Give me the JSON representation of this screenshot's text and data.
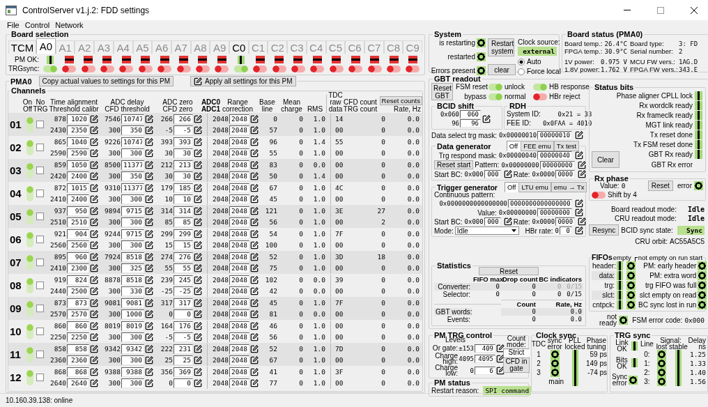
{
  "window": {
    "title": "ControlServer v1.j.2: FDD settings"
  },
  "menu": [
    "File",
    "Control",
    "Network"
  ],
  "board_selection": {
    "title": "Board selection",
    "tcm": {
      "label": "TCM",
      "selected": false
    },
    "pm_ok_label": "PM OK:",
    "trg_sync_label": "TRGsync:",
    "boards": [
      {
        "label": "A0",
        "selected": true,
        "pm_ok": true,
        "trg_sync": true
      },
      {
        "label": "A1",
        "selected": false,
        "pm_ok": false,
        "trg_sync": false
      },
      {
        "label": "A2",
        "selected": false,
        "pm_ok": false,
        "trg_sync": false
      },
      {
        "label": "A3",
        "selected": false,
        "pm_ok": false,
        "trg_sync": false
      },
      {
        "label": "A4",
        "selected": false,
        "pm_ok": false,
        "trg_sync": false
      },
      {
        "label": "A5",
        "selected": false,
        "pm_ok": false,
        "trg_sync": false
      },
      {
        "label": "A6",
        "selected": false,
        "pm_ok": false,
        "trg_sync": false
      },
      {
        "label": "A7",
        "selected": false,
        "pm_ok": false,
        "trg_sync": false
      },
      {
        "label": "A8",
        "selected": false,
        "pm_ok": false,
        "trg_sync": false
      },
      {
        "label": "A9",
        "selected": false,
        "pm_ok": false,
        "trg_sync": false
      },
      {
        "label": "C0",
        "selected": false,
        "pm_ok": true,
        "trg_sync": true
      },
      {
        "label": "C1",
        "selected": false,
        "pm_ok": false,
        "trg_sync": false
      },
      {
        "label": "C2",
        "selected": false,
        "pm_ok": false,
        "trg_sync": false
      },
      {
        "label": "C3",
        "selected": false,
        "pm_ok": false,
        "trg_sync": false
      },
      {
        "label": "C4",
        "selected": false,
        "pm_ok": false,
        "trg_sync": false
      },
      {
        "label": "C5",
        "selected": false,
        "pm_ok": false,
        "trg_sync": false
      },
      {
        "label": "C6",
        "selected": false,
        "pm_ok": false,
        "trg_sync": false
      },
      {
        "label": "C7",
        "selected": false,
        "pm_ok": false,
        "trg_sync": false
      },
      {
        "label": "C8",
        "selected": false,
        "pm_ok": false,
        "trg_sync": false
      },
      {
        "label": "C9",
        "selected": false,
        "pm_ok": false,
        "trg_sync": false
      }
    ]
  },
  "pm": {
    "title": "PMA0",
    "copy_button": "Copy actual values to settings for this PM",
    "apply_button": "Apply all settings for this PM",
    "channels": {
      "title": "Channels",
      "reset_button": "Reset counts",
      "columns": [
        {
          "lines": [
            "On",
            "Off"
          ],
          "bold": false
        },
        {
          "lines": [
            "No",
            "TRG"
          ],
          "bold": false
        },
        {
          "lines": [
            "Time alignment",
            "Threshold calibr"
          ],
          "bold": false
        },
        {
          "lines": [
            "ADC delay",
            "CFD threshold"
          ],
          "bold": false
        },
        {
          "lines": [
            "ADC zero",
            "CFD zero"
          ],
          "bold": false
        },
        {
          "lines": [
            "ADC0",
            "ADC1"
          ],
          "bold": true
        },
        {
          "lines": [
            "Range",
            "correction"
          ],
          "bold": false
        },
        {
          "lines": [
            "Base",
            "line"
          ],
          "bold": false
        },
        {
          "lines": [
            "Mean",
            "charge"
          ],
          "bold": false
        },
        {
          "lines": [
            "RMS"
          ],
          "bold": false
        },
        {
          "lines": [
            "TDC",
            "raw",
            "data"
          ],
          "bold": false
        },
        {
          "lines": [
            "CFD count",
            "TRG count"
          ],
          "bold": false
        },
        {
          "lines": [
            "Rate, Hz"
          ],
          "bold": false
        }
      ],
      "rows": [
        {
          "number": "01",
          "on": true,
          "no_trg": false,
          "lines": [
            [
              "878",
              "1020",
              "7546",
              "10747",
              "266",
              "266",
              "2048",
              "2048",
              "0",
              "0",
              "1.0",
              "14",
              "0",
              "0.0"
            ],
            [
              "2430",
              "2350",
              "300",
              "350",
              "-5",
              "-5",
              "2048",
              "2048",
              "57",
              "0",
              "1.0",
              "00",
              "0",
              "0.0"
            ]
          ]
        },
        {
          "number": "02",
          "on": true,
          "no_trg": false,
          "lines": [
            [
              "865",
              "1040",
              "9226",
              "10747",
              "393",
              "393",
              "2048",
              "2048",
              "96",
              "0",
              "1.4",
              "55",
              "0",
              "0.0"
            ],
            [
              "2590",
              "2590",
              "300",
              "300",
              "30",
              "30",
              "2048",
              "2048",
              "55",
              "0",
              "1.0",
              "00",
              "0",
              "0.0"
            ]
          ]
        },
        {
          "number": "03",
          "on": true,
          "no_trg": false,
          "lines": [
            [
              "859",
              "1050",
              "8500",
              "11377",
              "212",
              "213",
              "2048",
              "2048",
              "83",
              "0",
              "0.0",
              "00",
              "0",
              "0.0"
            ],
            [
              "2420",
              "2400",
              "300",
              "350",
              "30",
              "30",
              "2048",
              "2048",
              "50",
              "0",
              "1.4",
              "00",
              "0",
              "0.0"
            ]
          ]
        },
        {
          "number": "04",
          "on": true,
          "no_trg": false,
          "lines": [
            [
              "872",
              "1015",
              "9310",
              "11377",
              "179",
              "185",
              "2048",
              "2048",
              "67",
              "0",
              "1.0",
              "4C",
              "0",
              "0.0"
            ],
            [
              "2410",
              "2400",
              "300",
              "300",
              "10",
              "10",
              "2048",
              "2048",
              "45",
              "0",
              "1.0",
              "00",
              "0",
              "0.0"
            ]
          ]
        },
        {
          "number": "05",
          "on": true,
          "no_trg": false,
          "lines": [
            [
              "937",
              "950",
              "9894",
              "9715",
              "314",
              "314",
              "2048",
              "2048",
              "121",
              "0",
              "1.0",
              "3E",
              "27",
              "0.0"
            ],
            [
              "2510",
              "2510",
              "300",
              "300",
              "85",
              "85",
              "2048",
              "2048",
              "56",
              "0",
              "1.0",
              "00",
              "2",
              "0.0"
            ]
          ]
        },
        {
          "number": "06",
          "on": true,
          "no_trg": false,
          "lines": [
            [
              "921",
              "904",
              "9244",
              "9715",
              "299",
              "299",
              "2048",
              "2048",
              "54",
              "0",
              "1.0",
              "7F",
              "0",
              "0.0"
            ],
            [
              "2560",
              "2560",
              "300",
              "300",
              "15",
              "15",
              "2048",
              "2048",
              "100",
              "0",
              "1.0",
              "00",
              "0",
              "0.0"
            ]
          ]
        },
        {
          "number": "07",
          "on": true,
          "no_trg": false,
          "lines": [
            [
              "895",
              "960",
              "7924",
              "8518",
              "274",
              "276",
              "2048",
              "2048",
              "52",
              "0",
              "1.0",
              "3D",
              "18",
              "0.0"
            ],
            [
              "2410",
              "2300",
              "300",
              "325",
              "55",
              "55",
              "2048",
              "2048",
              "75",
              "0",
              "1.0",
              "00",
              "0",
              "0.0"
            ]
          ]
        },
        {
          "number": "08",
          "on": true,
          "no_trg": false,
          "lines": [
            [
              "919",
              "824",
              "8878",
              "8518",
              "239",
              "245",
              "2048",
              "2048",
              "102",
              "0",
              "0.0",
              "39",
              "0",
              "0.0"
            ],
            [
              "2440",
              "2500",
              "300",
              "330",
              "-25",
              "-25",
              "2048",
              "2048",
              "42",
              "0",
              "0.0",
              "00",
              "0",
              "0.0"
            ]
          ]
        },
        {
          "number": "09",
          "on": true,
          "no_trg": false,
          "lines": [
            [
              "873",
              "873",
              "9081",
              "9081",
              "317",
              "317",
              "2048",
              "2048",
              "45",
              "0",
              "1.0",
              "7F",
              "0",
              "0.0"
            ],
            [
              "2570",
              "2570",
              "300",
              "1000",
              "0",
              "0",
              "2048",
              "2048",
              "81",
              "0",
              "0.0",
              "00",
              "0",
              "0.0"
            ]
          ]
        },
        {
          "number": "10",
          "on": true,
          "no_trg": false,
          "lines": [
            [
              "860",
              "860",
              "8019",
              "8019",
              "164",
              "176",
              "2048",
              "2048",
              "46",
              "0",
              "1.0",
              "00",
              "0",
              "0.0"
            ],
            [
              "2250",
              "2250",
              "300",
              "300",
              "-5",
              "-5",
              "2048",
              "2048",
              "56",
              "0",
              "1.0",
              "00",
              "0",
              "0.0"
            ]
          ]
        },
        {
          "number": "11",
          "on": true,
          "no_trg": false,
          "lines": [
            [
              "858",
              "858",
              "9342",
              "9342",
              "222",
              "231",
              "2048",
              "2048",
              "52",
              "0",
              "1.0",
              "7D",
              "0",
              "0.0"
            ],
            [
              "2360",
              "2360",
              "300",
              "300",
              "25",
              "25",
              "2048",
              "2048",
              "67",
              "0",
              "1.0",
              "00",
              "0",
              "0.0"
            ]
          ]
        },
        {
          "number": "12",
          "on": true,
          "no_trg": false,
          "lines": [
            [
              "868",
              "868",
              "9388",
              "9388",
              "356",
              "369",
              "2048",
              "2048",
              "41",
              "0",
              "1.0",
              "3F",
              "0",
              "0.0"
            ],
            [
              "2640",
              "2640",
              "300",
              "300",
              "0",
              "0",
              "2048",
              "2048",
              "77",
              "0",
              "1.0",
              "00",
              "0",
              "0.0"
            ]
          ]
        }
      ]
    }
  },
  "system": {
    "title": "System",
    "indicators": [
      {
        "label": "is restarting",
        "ok": true
      },
      {
        "label": "restarted",
        "ok": true
      },
      {
        "label": "Errors present",
        "ok": true
      }
    ],
    "restart_button": "Restart system",
    "clear_button": "clear",
    "clock_source": {
      "label": "Clock source:",
      "value": "external",
      "options": [
        {
          "label": "Auto",
          "selected": true
        },
        {
          "label": "Force local",
          "selected": false
        }
      ]
    }
  },
  "board_status": {
    "title": "Board status (PMA0)",
    "items": [
      {
        "label": "Board temp.:",
        "value": "26.4°C"
      },
      {
        "label": "FPGA temp.:",
        "value": "30.9°C"
      },
      {
        "label": "1V power:",
        "value": "0.975 V"
      },
      {
        "label": "1.8V power:",
        "value": "1.762 V"
      }
    ],
    "items_2": [
      {
        "label": "Board type:",
        "value": "3: FD"
      },
      {
        "label": "Serial number:",
        "value": "2"
      },
      {
        "label": "MCU FW vers.:",
        "value": "1AG.D"
      },
      {
        "label": "FPGA FW vers.:",
        "value": "343.E"
      }
    ]
  },
  "gbt": {
    "title": "GBT readout",
    "reset_button": "Reset GBT",
    "switches": [
      {
        "off_label": "FSM reset",
        "on_label": "unlock",
        "on": true
      },
      {
        "off_label": "bypass",
        "on_label": "normal",
        "on": true
      }
    ],
    "hb_switches": [
      {
        "label": "HB response",
        "on": true
      },
      {
        "label": "HBr reject",
        "on": false
      }
    ],
    "bcid_shift": {
      "title": "BCID shift",
      "rows": [
        {
          "actual": "0x060",
          "value": "060"
        },
        {
          "actual": "96",
          "value": "96"
        }
      ]
    },
    "rdh": {
      "title": "RDH",
      "rows": [
        {
          "label": "System ID:",
          "value": "0x21 = 33"
        },
        {
          "label": "FEE ID:",
          "value": "0x0FAA = 4010"
        }
      ]
    },
    "trg_mask": {
      "label": "Data select trg mask:",
      "actual": "0x00000010",
      "value": "00000010"
    },
    "data_generator": {
      "title": "Data generator",
      "modes": [
        {
          "label": "Off",
          "selected": true
        },
        {
          "label": "FEE emu",
          "selected": false
        },
        {
          "label": "Tx test",
          "selected": false
        }
      ],
      "respond_mask": {
        "label": "Trg respond mask:",
        "actual": "0x00000040",
        "value": "00000040"
      },
      "reset_button": "Reset start",
      "pattern": {
        "label": "Pattern:",
        "actual": "0x00000000",
        "value": "00000000"
      },
      "start_bc": {
        "label": "Start BC:",
        "actual": "0x000",
        "value": "000"
      },
      "rate": {
        "label": "Rate:",
        "actual": "0x0000",
        "value": "0000"
      }
    },
    "trigger_generator": {
      "title": "Trigger generator",
      "modes": [
        {
          "label": "Off",
          "selected": true
        },
        {
          "label": "LTU emu",
          "selected": false
        },
        {
          "label": "emu → Tx",
          "selected": false
        }
      ],
      "pattern_label": "Continuous pattern:",
      "pattern": {
        "actual": "0x0000000000000000",
        "value": "0000000000000000"
      },
      "value": {
        "label": "Value:",
        "actual": "0x00000000",
        "value": "00000000"
      },
      "start_bc": {
        "label": "Start BC:",
        "actual": "0x000",
        "value": "000"
      },
      "rate": {
        "label": "Rate:",
        "actual": "0x0000",
        "value": "0000"
      },
      "mode": {
        "label": "Mode:",
        "value": "Idle"
      },
      "hbr_rate": {
        "label": "HBr rate:",
        "actual": "0",
        "value": "0"
      }
    },
    "statistics": {
      "title": "Statistics",
      "reset_button": "Reset",
      "fifo_columns": [
        "FIFO max",
        "Drop count",
        "BC indicators"
      ],
      "fifo_rows": [
        {
          "label": "Converter:",
          "fifo_max": "0",
          "drop_count": "0",
          "bc": "0",
          "bc_total": "0/15",
          "disabled": true
        },
        {
          "label": "Selector:",
          "fifo_max": "0",
          "drop_count": "0",
          "bc": "0",
          "bc_total": "0/15",
          "disabled": false
        }
      ],
      "rate_columns": [
        "Count",
        "Rate, Hz"
      ],
      "rate_rows": [
        {
          "label": "GBT words:",
          "count": "0",
          "rate": "0.0"
        },
        {
          "label": "Events:",
          "count": "0",
          "rate": "0.0"
        }
      ]
    },
    "status_bits": {
      "title": "Status bits",
      "clear_button": "Clear",
      "bits": [
        {
          "label": "Phase aligner CPLL lock",
          "lit": true
        },
        {
          "label": "Rx wordclk ready",
          "lit": true
        },
        {
          "label": "Rx frameclk ready",
          "lit": true
        },
        {
          "label": "MGT link ready",
          "lit": true
        },
        {
          "label": "Tx reset done",
          "lit": true
        },
        {
          "label": "Tx FSM reset done",
          "lit": true
        },
        {
          "label": "GBT Rx ready",
          "lit": true
        },
        {
          "label": "GBT Rx error",
          "lit": false
        }
      ]
    },
    "rx_phase": {
      "title": "Rx phase",
      "value_label": "Value:",
      "value": "0",
      "reset_button": "Reset",
      "error_label": "error",
      "error_ok": true,
      "shift": {
        "label": "Shift by 4",
        "on": false
      }
    },
    "readout": [
      {
        "label": "Board readout mode:",
        "value": "Idle"
      },
      {
        "label": "CRU readout mode:",
        "value": "Idle"
      }
    ],
    "resync_button": "Resync",
    "bcid_sync": {
      "label": "BCID sync state:",
      "value": "Sync",
      "ok": true
    },
    "cru_orbit": {
      "label": "CRU orbit:",
      "value": "AC55A5C5"
    },
    "fifos": {
      "title": "FIFOs",
      "empty_label": "empty",
      "flag_label": "not empty on run start",
      "rows": [
        {
          "label": "header:",
          "empty": true,
          "ok": true,
          "flag": "PM: early header",
          "flag_ok": true
        },
        {
          "label": "data:",
          "empty": true,
          "ok": true,
          "flag": "PM: extra word",
          "flag_ok": true
        },
        {
          "label": "trg:",
          "empty": true,
          "ok": true,
          "flag": "trg FIFO was full",
          "flag_ok": true
        },
        {
          "label": "slct:",
          "empty": true,
          "ok": true,
          "flag": "slct empty on read",
          "flag_ok": true
        },
        {
          "label": "cntpck:",
          "empty": true,
          "ok": true,
          "flag": "BC sync lost in run",
          "flag_ok": true
        }
      ]
    },
    "not_ready": {
      "label": "not ready",
      "ok": true
    },
    "fsm_error": {
      "label": "FSM error code:",
      "value": "0x000"
    }
  },
  "pm_trg": {
    "title": "PM TRG control",
    "levels_label": "Levels",
    "levels": [
      {
        "label": "Or gate:",
        "actual": "±153",
        "value": "409"
      },
      {
        "label": "Charge high:",
        "actual": "4095",
        "value": "4095"
      },
      {
        "label": "Charge low:",
        "actual": "0",
        "value": "6"
      }
    ],
    "count_mode_label": "Count mode:",
    "count_modes": [
      {
        "label": "Strict",
        "selected": true
      },
      {
        "label": "CFD in gate",
        "selected": false
      }
    ]
  },
  "pm_status": {
    "title": "PM status",
    "label": "Restart reason:",
    "value": "SPI command"
  },
  "clock_sync": {
    "title": "Clock sync",
    "columns": [
      "TDC",
      "sync error",
      "PLL locked",
      "Phase tuning"
    ],
    "rows": [
      {
        "tdc": "1",
        "sync_ok": true,
        "pll_ok": true,
        "phase": "59 ps"
      },
      {
        "tdc": "2",
        "sync_ok": true,
        "pll_ok": true,
        "phase": "149 ps"
      },
      {
        "tdc": "3",
        "sync_ok": true,
        "pll_ok": true,
        "phase": "-74 ps"
      }
    ],
    "main": {
      "label": "main",
      "pll_ok": true
    }
  },
  "trg_sync": {
    "title": "TRG sync",
    "link": {
      "label": "Link OK",
      "ok": true
    },
    "bits": {
      "label": "Bits OK",
      "ok": true
    },
    "sync_error": {
      "label": "Sync error",
      "ok": true
    },
    "line_label": "Line",
    "signal_label": "Signal:",
    "lost_label": "lost",
    "stable_label": "stable",
    "delay_label": "Delay ns",
    "rows": [
      {
        "line": "0:",
        "lost_ok": true,
        "stable_ok": true,
        "delay": "1.25"
      },
      {
        "line": "1:",
        "lost_ok": true,
        "stable_ok": true,
        "delay": "1.33"
      },
      {
        "line": "2:",
        "lost_ok": true,
        "stable_ok": true,
        "delay": "1.40"
      },
      {
        "line": "3:",
        "lost_ok": true,
        "stable_ok": true,
        "delay": "1.56"
      }
    ]
  },
  "status_bar": {
    "text": "10.160.39.138: online"
  }
}
